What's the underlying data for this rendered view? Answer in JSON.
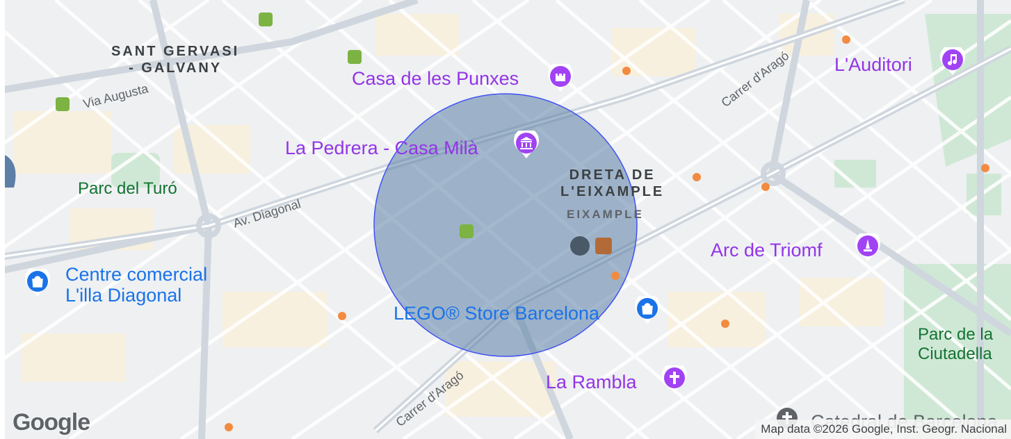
{
  "map": {
    "districts": [
      {
        "name": "SANT GERVASI\n- GALVANY"
      },
      {
        "name": "DRETA DE\nL'EIXAMPLE"
      },
      {
        "name": "EIXAMPLE"
      }
    ],
    "pois": [
      {
        "label": "Casa de les Punxes",
        "icon": "castle-icon"
      },
      {
        "label": "La Pedrera - Casa Milà",
        "icon": "museum-icon"
      },
      {
        "label": "L'Auditori",
        "icon": "music-note-icon"
      },
      {
        "label": "Arc de Triomf",
        "icon": "monument-icon"
      },
      {
        "label": "Centre comercial\nL'illa Diagonal",
        "icon": "shopping-bag-icon"
      },
      {
        "label": "LEGO® Store Barcelona",
        "icon": "shopping-bag-icon"
      },
      {
        "label": "La Rambla",
        "icon": "landmark-cross-icon"
      },
      {
        "label": "Catedral de Barcelona",
        "icon": "church-icon"
      }
    ],
    "parks": [
      "Parc del Turó",
      "Parc de la\nCiutadella"
    ],
    "streets": [
      "Via Augusta",
      "Av. Diagonal",
      "Carrer d'Aragó",
      "Carrer d'Aragó"
    ],
    "circle_overlay": {
      "fill": "#5b7fa6",
      "stroke": "#3f51f5"
    },
    "attribution": "Map data ©2026 Google, Inst. Geogr. Nacional",
    "logo": "Google",
    "colors": {
      "poi_purple": "#9334e6",
      "poi_blue": "#1a73e8",
      "park_green": "#137333"
    }
  }
}
